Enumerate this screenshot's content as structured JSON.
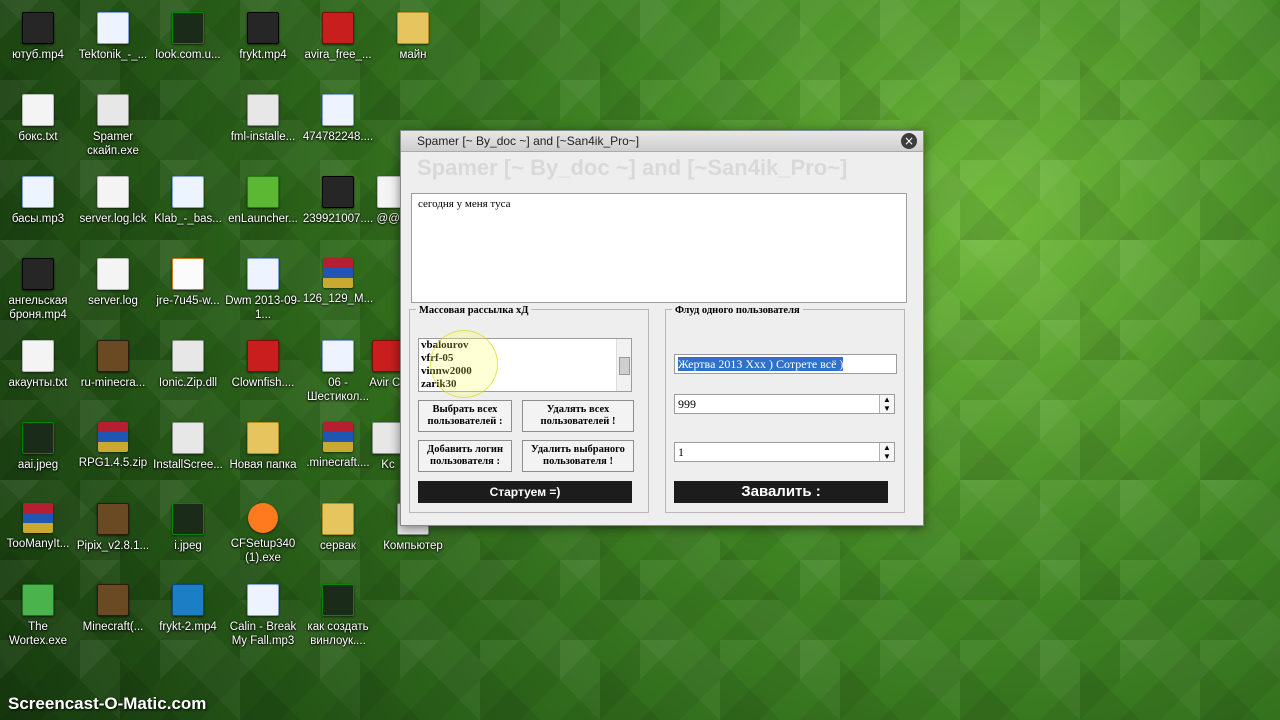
{
  "desktop": {
    "icons": [
      {
        "label": "ютуб.mp4",
        "kind": "video"
      },
      {
        "label": "Tektonik_-_...",
        "kind": "media"
      },
      {
        "label": "look.com.u...",
        "kind": "dark"
      },
      {
        "label": "frykt.mp4",
        "kind": "video"
      },
      {
        "label": "avira_free_...",
        "kind": "red"
      },
      {
        "label": "майн",
        "kind": "folder"
      },
      {
        "label": "бокс.txt",
        "kind": "doc"
      },
      {
        "label": "Spamer\nскайп.exe",
        "kind": "app"
      },
      {
        "label": "fml-installe...",
        "kind": "app"
      },
      {
        "label": "474782248....",
        "kind": "media"
      },
      {
        "label": "басы.mp3",
        "kind": "media"
      },
      {
        "label": "server.log.lck",
        "kind": "doc"
      },
      {
        "label": "Klab_-_bas...",
        "kind": "media"
      },
      {
        "label": "enLauncher...",
        "kind": "green"
      },
      {
        "label": "239921007....",
        "kind": "video"
      },
      {
        "label": "@@...",
        "kind": "doc"
      },
      {
        "label": "ангельская\nброня.mp4",
        "kind": "video"
      },
      {
        "label": "server.log",
        "kind": "doc"
      },
      {
        "label": "jre-7u45-w...",
        "kind": "java"
      },
      {
        "label": "Dwm\n2013-09-1...",
        "kind": "media"
      },
      {
        "label": "126_129_M...",
        "kind": "archive"
      },
      {
        "label": "акаунты.txt",
        "kind": "doc"
      },
      {
        "label": "ru-minecra...",
        "kind": "cube"
      },
      {
        "label": "Ionic.Zip.dll",
        "kind": "app"
      },
      {
        "label": "Clownfish....",
        "kind": "red"
      },
      {
        "label": "06 -\nШестикол...",
        "kind": "media"
      },
      {
        "label": "Avir\nCe",
        "kind": "red"
      },
      {
        "label": "aai.jpeg",
        "kind": "dark"
      },
      {
        "label": "RPG1.4.5.zip",
        "kind": "archive"
      },
      {
        "label": "InstallScree...",
        "kind": "app"
      },
      {
        "label": "Новая папка",
        "kind": "folder"
      },
      {
        "label": ".minecraft....",
        "kind": "archive"
      },
      {
        "label": "Kc",
        "kind": "app"
      },
      {
        "label": "TooManyIt...",
        "kind": "archive"
      },
      {
        "label": "Pipix_v2.8.1...",
        "kind": "cube"
      },
      {
        "label": "i.jpeg",
        "kind": "dark"
      },
      {
        "label": "CFSetup340\n(1).exe",
        "kind": "fish"
      },
      {
        "label": "сервак",
        "kind": "folder"
      },
      {
        "label": "Компьютер",
        "kind": "app"
      },
      {
        "label": "The\nWortex.exe",
        "kind": "creeper"
      },
      {
        "label": "Minecraft(...",
        "kind": "cube"
      },
      {
        "label": "frykt-2.mp4",
        "kind": "blue"
      },
      {
        "label": "Calin - Break\nMy Fall.mp3",
        "kind": "media"
      },
      {
        "label": "как создать\nвинлоук....",
        "kind": "dark"
      }
    ]
  },
  "window": {
    "title": "Spamer [~ By_doc ~] and [~San4ik_Pro~]",
    "ghost_title": "Spamer [~ By_doc ~] and [~San4ik_Pro~]",
    "message": "сегодня у меня туса",
    "left_group": {
      "title": "Массовая рассылка хД",
      "users": [
        "vbalourov",
        "vfrf-05",
        "vinnw2000",
        "zarik30"
      ],
      "buttons": {
        "select_all": "Выбрать всех\nпользователей :",
        "delete_all": "Удалять всех\nпользователей !",
        "add_logins": "Добавить логин\nпользователя :",
        "delete_selected": "Удалить выбраного\nпользователя !",
        "start": "Стартуем =)"
      }
    },
    "right_group": {
      "title": "Флуд одного пользователя",
      "victim": "Жертва 2013 Ххх ) Сотрете всё )",
      "count_value": "999",
      "delay_value": "1",
      "flood_button": "Завалить :"
    }
  },
  "watermark": "Screencast-O-Matic.com"
}
